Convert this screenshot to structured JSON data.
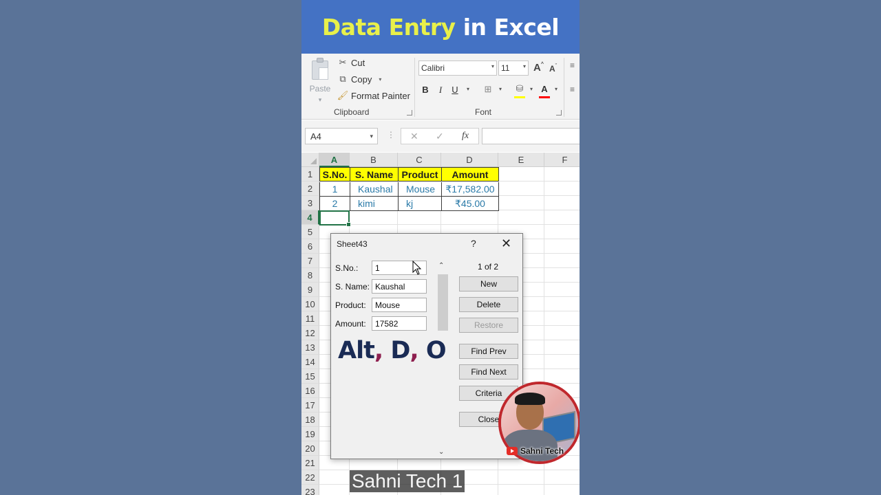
{
  "banner": {
    "word1": "Data",
    "word2": "Entry",
    "word3": "in",
    "word4": "Excel"
  },
  "ribbon": {
    "paste_label": "Paste",
    "cut_label": "Cut",
    "copy_label": "Copy",
    "format_painter_label": "Format Painter",
    "clipboard_group": "Clipboard",
    "font_name": "Calibri",
    "font_size": "11",
    "bold": "B",
    "italic": "I",
    "underline": "U",
    "grow_font": "A",
    "shrink_font": "A",
    "font_color": "A",
    "font_group": "Font"
  },
  "formula_bar": {
    "name_box": "A4",
    "cancel_icon": "✕",
    "enter_icon": "✓",
    "fx_label": "fx",
    "value": ""
  },
  "sheet": {
    "columns": [
      "A",
      "B",
      "C",
      "D",
      "E",
      "F"
    ],
    "rows": [
      "1",
      "2",
      "3",
      "4",
      "5",
      "6",
      "7",
      "8",
      "9",
      "10",
      "11",
      "12",
      "13",
      "14",
      "15",
      "16",
      "17",
      "18",
      "19",
      "20",
      "21",
      "22",
      "23"
    ],
    "headers": [
      "S.No.",
      "S. Name",
      "Product",
      "Amount"
    ],
    "data": [
      [
        "1",
        "Kaushal",
        "Mouse",
        "₹17,582.00"
      ],
      [
        "2",
        "kimi",
        "kj",
        "₹45.00"
      ]
    ],
    "selected_cell": "A4"
  },
  "dialog": {
    "title": "Sheet43",
    "help": "?",
    "close": "✕",
    "record_counter": "1 of 2",
    "fields": [
      {
        "label": "S.No.:",
        "value": "1"
      },
      {
        "label": "S. Name:",
        "value": "Kaushal"
      },
      {
        "label": "Product:",
        "value": "Mouse"
      },
      {
        "label": "Amount:",
        "value": "17582"
      }
    ],
    "buttons": {
      "new": "New",
      "delete": "Delete",
      "restore": "Restore",
      "find_prev": "Find Prev",
      "find_next": "Find Next",
      "criteria": "Criteria",
      "close": "Close"
    }
  },
  "shortcut": {
    "k1": "Alt",
    "sep1": ",",
    "k2": "D",
    "sep2": ",",
    "k3": "O"
  },
  "channel": {
    "name": "Sahni Tech",
    "watermark": "Sahni Tech 1"
  },
  "colors": {
    "banner_bg": "#4472c4",
    "banner_accent": "#e8f04a",
    "header_fill": "#ffff00",
    "data_text": "#2a7aa8",
    "excel_green": "#217346",
    "page_bg": "#5a7398"
  }
}
